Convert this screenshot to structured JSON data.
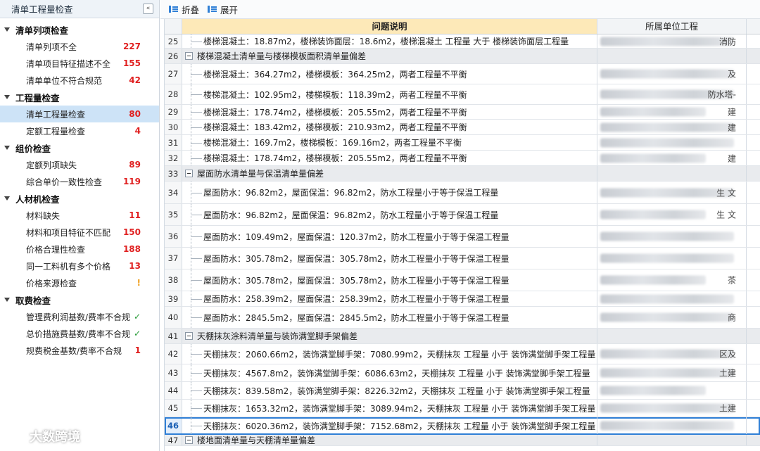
{
  "sidebar": {
    "title": "清单工程量检查",
    "collapse_icon": "«",
    "groups": [
      {
        "label": "清单列项检查",
        "items": [
          {
            "label": "清单列项不全",
            "count": "227"
          },
          {
            "label": "清单项目特征描述不全",
            "count": "155"
          },
          {
            "label": "清单单位不符合规范",
            "count": "42"
          }
        ]
      },
      {
        "label": "工程量检查",
        "items": [
          {
            "label": "清单工程量检查",
            "count": "80"
          },
          {
            "label": "定额工程量检查",
            "count": "4"
          }
        ]
      },
      {
        "label": "组价检查",
        "items": [
          {
            "label": "定额列项缺失",
            "count": "89"
          },
          {
            "label": "综合单价一致性检查",
            "count": "119"
          }
        ]
      },
      {
        "label": "人材机检查",
        "items": [
          {
            "label": "材料缺失",
            "count": "11"
          },
          {
            "label": "材料和项目特征不匹配",
            "count": "150"
          },
          {
            "label": "价格合理性检查",
            "count": "188"
          },
          {
            "label": "同一工料机有多个价格",
            "count": "13"
          },
          {
            "label": "价格来源检查",
            "count": "!"
          }
        ]
      },
      {
        "label": "取费检查",
        "items": [
          {
            "label": "管理费利润基数/费率不合规",
            "count": "✓"
          },
          {
            "label": "总价措施费基数/费率不合规",
            "count": "✓"
          },
          {
            "label": "规费税金基数/费率不合规",
            "count": "1"
          }
        ]
      }
    ]
  },
  "toolbar": {
    "collapse_label": "折叠",
    "expand_label": "展开"
  },
  "grid": {
    "headers": {
      "description": "问题说明",
      "unit": "所属单位工程"
    },
    "rows": [
      {
        "num": "25",
        "desc": "楼梯混凝土：18.87m2，楼梯装饰面层：18.6m2，楼梯混凝土 工程量 大于 楼梯装饰面层工程量",
        "unit": "消防"
      },
      {
        "num": "26",
        "desc": "楼梯混凝土清单量与楼梯模板面积清单量偏差",
        "group": true
      },
      {
        "num": "27",
        "desc": "楼梯混凝土：364.27m2，楼梯模板：364.25m2，两者工程量不平衡",
        "unit": "及"
      },
      {
        "num": "28",
        "desc": "楼梯混凝土：102.95m2，楼梯模板：118.39m2，两者工程量不平衡",
        "unit": "防水塔-"
      },
      {
        "num": "29",
        "desc": "楼梯混凝土：178.74m2，楼梯模板：205.55m2，两者工程量不平衡",
        "unit": "建"
      },
      {
        "num": "30",
        "desc": "楼梯混凝土：183.42m2，楼梯模板：210.93m2，两者工程量不平衡",
        "unit": "建"
      },
      {
        "num": "31",
        "desc": "楼梯混凝土：169.7m2，楼梯模板：169.16m2，两者工程量不平衡",
        "unit": ""
      },
      {
        "num": "32",
        "desc": "楼梯混凝土：178.74m2，楼梯模板：205.55m2，两者工程量不平衡",
        "unit": "建"
      },
      {
        "num": "33",
        "desc": "屋面防水清单量与保温清单量偏差",
        "group": true
      },
      {
        "num": "34",
        "desc": "屋面防水：96.82m2，屋面保温：96.82m2，防水工程量小于等于保温工程量",
        "unit": "生 文"
      },
      {
        "num": "35",
        "desc": "屋面防水：96.82m2，屋面保温：96.82m2，防水工程量小于等于保温工程量",
        "unit": "生 文"
      },
      {
        "num": "36",
        "desc": "屋面防水：109.49m2，屋面保温：120.37m2，防水工程量小于等于保温工程量",
        "unit": ""
      },
      {
        "num": "37",
        "desc": "屋面防水：305.78m2，屋面保温：305.78m2，防水工程量小于等于保温工程量",
        "unit": ""
      },
      {
        "num": "38",
        "desc": "屋面防水：305.78m2，屋面保温：305.78m2，防水工程量小于等于保温工程量",
        "unit": "茶"
      },
      {
        "num": "39",
        "desc": "屋面防水：258.39m2，屋面保温：258.39m2，防水工程量小于等于保温工程量",
        "unit": ""
      },
      {
        "num": "40",
        "desc": "屋面防水：2845.5m2，屋面保温：2845.5m2，防水工程量小于等于保温工程量",
        "unit": "商"
      },
      {
        "num": "41",
        "desc": "天棚抹灰涂料清单量与装饰满堂脚手架偏差",
        "group": true
      },
      {
        "num": "42",
        "desc": "天棚抹灰：2060.66m2，装饰满堂脚手架：7080.99m2，天棚抹灰 工程量 小于 装饰满堂脚手架工程量",
        "unit": "区及"
      },
      {
        "num": "43",
        "desc": "天棚抹灰：4567.8m2，装饰满堂脚手架：6086.63m2，天棚抹灰 工程量 小于 装饰满堂脚手架工程量",
        "unit": "土建"
      },
      {
        "num": "44",
        "desc": "天棚抹灰：839.58m2，装饰满堂脚手架：8226.32m2，天棚抹灰 工程量 小于 装饰满堂脚手架工程量",
        "unit": ""
      },
      {
        "num": "45",
        "desc": "天棚抹灰：1653.32m2，装饰满堂脚手架：3089.94m2，天棚抹灰 工程量 小于 装饰满堂脚手架工程量",
        "unit": "土建"
      },
      {
        "num": "46",
        "desc": "天棚抹灰：6020.36m2，装饰满堂脚手架：7152.68m2，天棚抹灰 工程量 小于 装饰满堂脚手架工程量",
        "unit": "",
        "active": true
      },
      {
        "num": "47",
        "desc": "楼地面清单量与天棚清单量偏差",
        "group": true
      }
    ]
  },
  "watermark": "大数跨境"
}
